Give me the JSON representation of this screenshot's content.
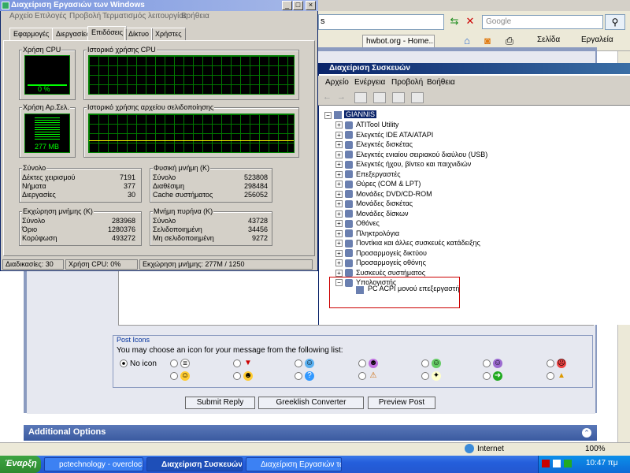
{
  "ie": {
    "search_placeholder": "Google",
    "address_tail": "s",
    "tab1": "hwbot.org - Home...",
    "cmd_page": "Σελίδα",
    "cmd_tools": "Εργαλεία",
    "status_zone": "Internet",
    "zoom": "100%"
  },
  "forum": {
    "post_icons_title": "Post Icons",
    "post_icons_text": "You may choose an icon for your message from the following list:",
    "no_icon": "No icon",
    "submit": "Submit Reply",
    "greeklish": "Greeklish Converter",
    "preview": "Preview Post",
    "additional": "Additional Options"
  },
  "taskmgr": {
    "title": "Διαχείριση Εργασιών των Windows",
    "menu": [
      "Αρχείο",
      "Επιλογές",
      "Προβολή",
      "Τερματισμός λειτουργίας",
      "Βοήθεια"
    ],
    "tabs": [
      "Εφαρμογές",
      "Διεργασίες",
      "Επιδόσεις",
      "Δίκτυο",
      "Χρήστες"
    ],
    "cpu_label": "Χρήση CPU",
    "cpu_value": "0 %",
    "cpu_usage": 0,
    "cpu_hist": "Ιστορικό χρήσης CPU",
    "pf_label": "Χρήση Αρ.Σελ.",
    "pf_value": "277 MB",
    "pf_hist": "Ιστορικό χρήσης αρχείου σελιδοποίησης",
    "totals": {
      "title": "Σύνολο",
      "rows": [
        [
          "Δέκτες χειρισμού",
          "7191"
        ],
        [
          "Νήματα",
          "377"
        ],
        [
          "Διεργασίες",
          "30"
        ]
      ]
    },
    "phys": {
      "title": "Φυσική μνήμη (K)",
      "rows": [
        [
          "Σύνολο",
          "523808"
        ],
        [
          "Διαθέσιμη",
          "298484"
        ],
        [
          "Cache συστήματος",
          "256052"
        ]
      ]
    },
    "commit": {
      "title": "Εκχώρηση μνήμης (K)",
      "rows": [
        [
          "Σύνολο",
          "283968"
        ],
        [
          "Όριο",
          "1280376"
        ],
        [
          "Κορύφωση",
          "493272"
        ]
      ]
    },
    "kernel": {
      "title": "Μνήμη πυρήνα (K)",
      "rows": [
        [
          "Σύνολο",
          "43728"
        ],
        [
          "Σελιδοποιημένη",
          "34456"
        ],
        [
          "Μη σελιδοποιημένη",
          "9272"
        ]
      ]
    },
    "status": [
      "Διαδικασίες: 30",
      "Χρήση CPU: 0%",
      "Εκχώρηση μνήμης: 277M / 1250"
    ]
  },
  "devmgr": {
    "title": "Διαχείριση Συσκευών",
    "menu": [
      "Αρχείο",
      "Ενέργεια",
      "Προβολή",
      "Βοήθεια"
    ],
    "root": "GIANNIS",
    "items": [
      "ATITool Utility",
      "Ελεγκτές IDE ATA/ATAPI",
      "Ελεγκτές δισκέτας",
      "Ελεγκτές ενιαίου σειριακού διαύλου (USB)",
      "Ελεγκτές ήχου, βίντεο και παιχνιδιών",
      "Επεξεργαστές",
      "Θύρες (COM & LPT)",
      "Μονάδες DVD/CD-ROM",
      "Μονάδες δισκέτας",
      "Μονάδες δίσκων",
      "Οθόνες",
      "Πληκτρολόγια",
      "Ποντίκια και άλλες συσκευές κατάδειξης",
      "Προσαρμογείς δικτύου",
      "Προσαρμογείς οθόνης",
      "Συσκευές συστήματος",
      "Υπολογιστής"
    ],
    "child": "PC ACPI μονού επεξεργαστή"
  },
  "taskbar": {
    "start": "Έναρξη",
    "items": [
      "pctechnology - overclock...",
      "Διαχείριση Συσκευών",
      "Διαχείριση Εργασιών των..."
    ],
    "clock": "10:47 πμ"
  }
}
